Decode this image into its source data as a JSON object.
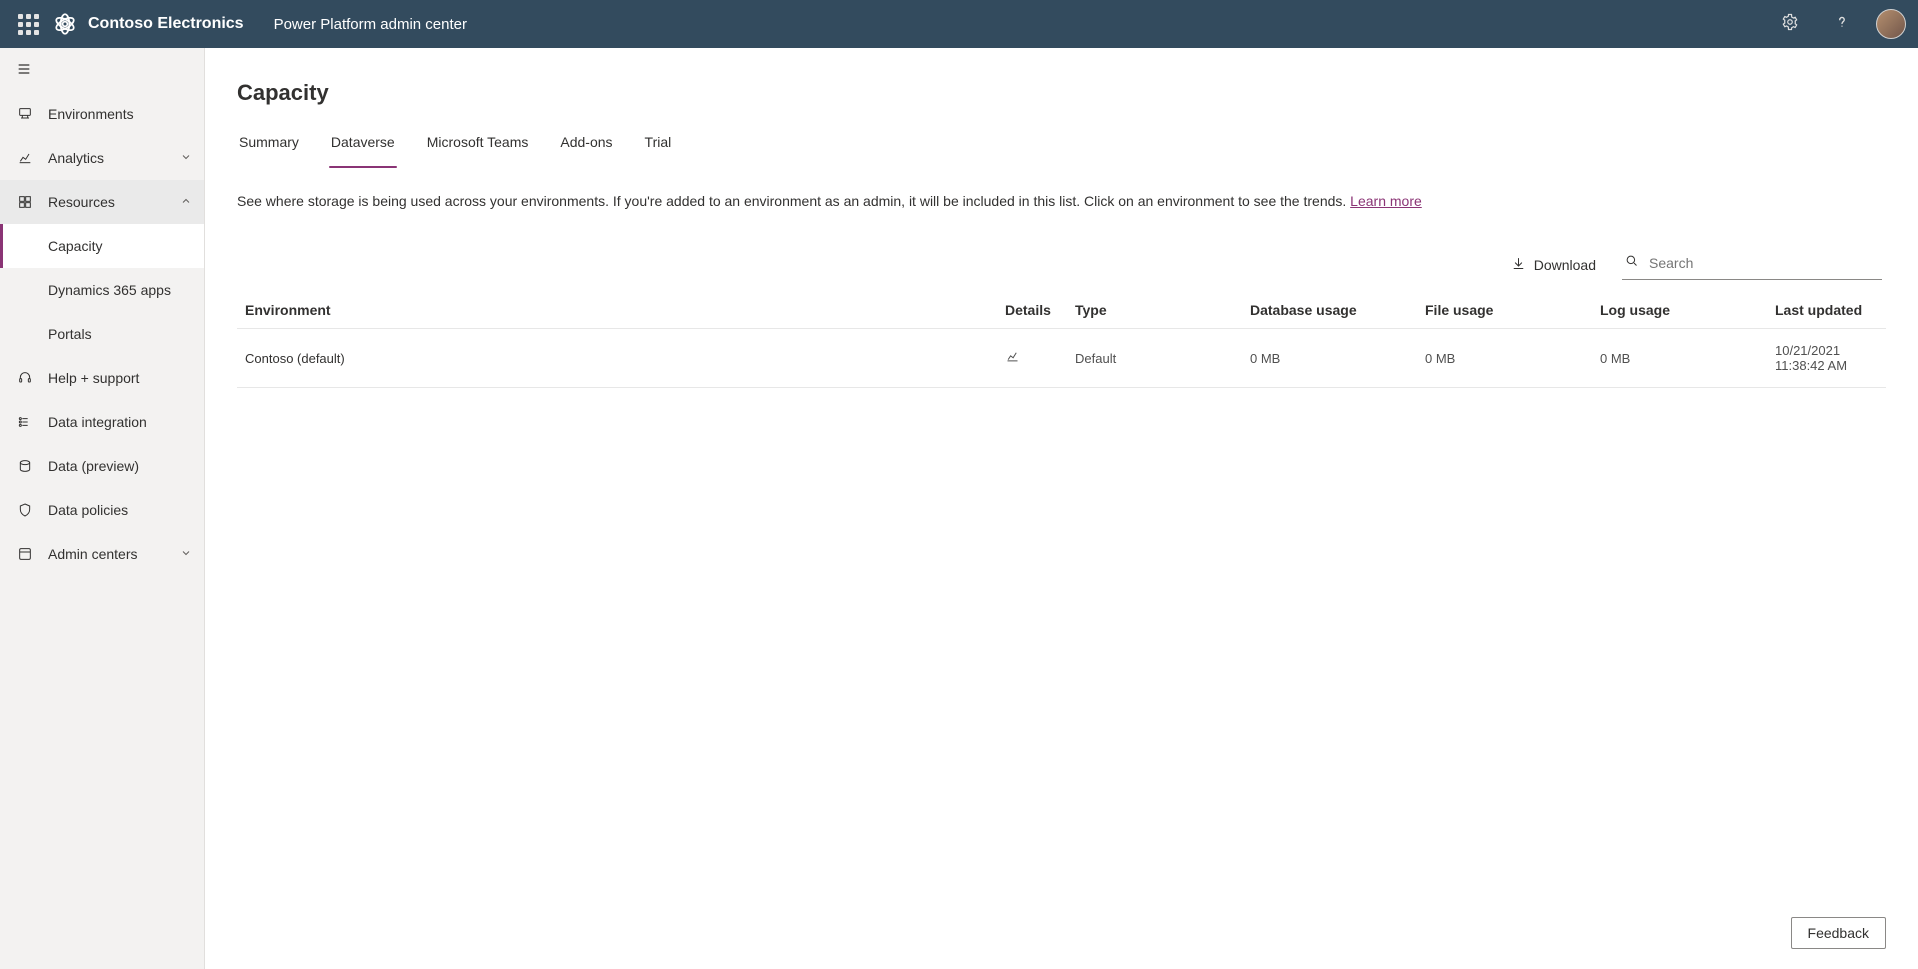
{
  "header": {
    "brand": "Contoso Electronics",
    "app": "Power Platform admin center"
  },
  "sidebar": {
    "environments": "Environments",
    "analytics": "Analytics",
    "resources": "Resources",
    "resources_children": {
      "capacity": "Capacity",
      "d365": "Dynamics 365 apps",
      "portals": "Portals"
    },
    "help": "Help + support",
    "data_integration": "Data integration",
    "data_preview": "Data (preview)",
    "data_policies": "Data policies",
    "admin_centers": "Admin centers"
  },
  "page": {
    "title": "Capacity",
    "tabs": {
      "summary": "Summary",
      "dataverse": "Dataverse",
      "teams": "Microsoft Teams",
      "addons": "Add-ons",
      "trial": "Trial"
    },
    "description": "See where storage is being used across your environments. If you're added to an environment as an admin, it will be included in this list. Click on an environment to see the trends.",
    "learn_more": "Learn more",
    "download": "Download",
    "search_placeholder": "Search",
    "columns": {
      "environment": "Environment",
      "details": "Details",
      "type": "Type",
      "db": "Database usage",
      "file": "File usage",
      "log": "Log usage",
      "updated": "Last updated"
    },
    "rows": [
      {
        "environment": "Contoso (default)",
        "type": "Default",
        "db": "0 MB",
        "file": "0 MB",
        "log": "0 MB",
        "updated": "10/21/2021 11:38:42 AM"
      }
    ],
    "feedback": "Feedback"
  }
}
